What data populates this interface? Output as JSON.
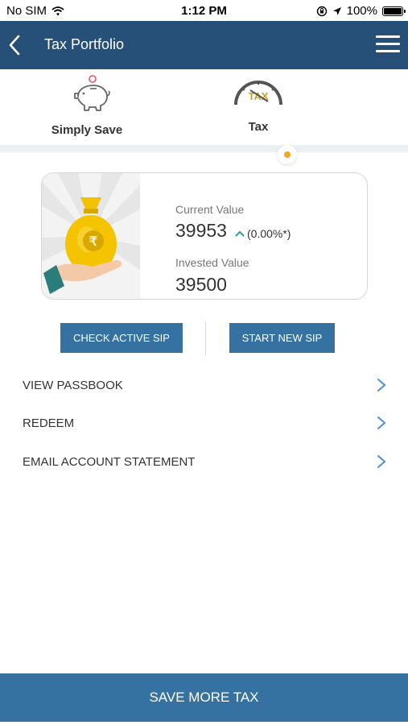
{
  "status_bar": {
    "carrier": "No SIM",
    "time": "1:12 PM",
    "battery": "100%"
  },
  "header": {
    "title": "Tax Portfolio"
  },
  "tabs": [
    {
      "label": "Simply Save",
      "icon": "piggy-bank-icon"
    },
    {
      "label": "Tax",
      "icon": "tax-meter-icon",
      "selected": true
    }
  ],
  "portfolio": {
    "current_value_label": "Current Value",
    "current_value": "39953",
    "change": "(0.00%*)",
    "invested_value_label": "Invested Value",
    "invested_value": "39500"
  },
  "actions": {
    "check_active_sip": "CHECK ACTIVE SIP",
    "start_new_sip": "START NEW SIP"
  },
  "menu_items": [
    {
      "label": "VIEW PASSBOOK"
    },
    {
      "label": "REDEEM"
    },
    {
      "label": "EMAIL ACCOUNT STATEMENT"
    }
  ],
  "footer": {
    "cta": "SAVE MORE TAX"
  },
  "colors": {
    "nav": "#275078",
    "button": "#3672a1",
    "accent_dot": "#f5a623",
    "chevron": "#4a90d9"
  }
}
